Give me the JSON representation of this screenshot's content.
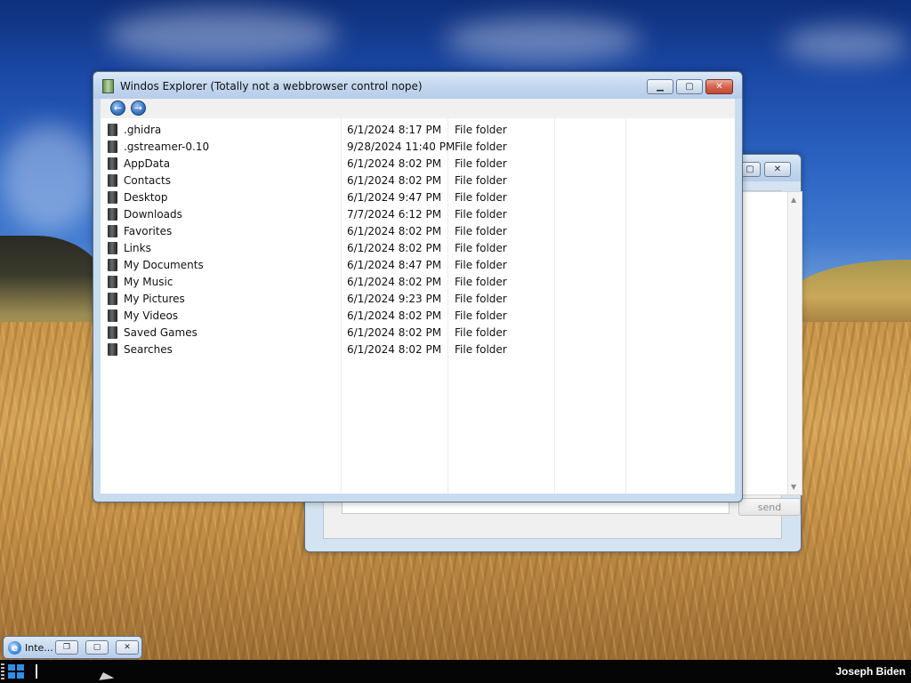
{
  "explorer": {
    "title": "Windos Explorer (Totally not a webbrowser control nope)",
    "buttons": {
      "minimize": "▁",
      "maximize": "▢",
      "close": "✕",
      "back": "←",
      "forward": "→"
    },
    "rows": [
      {
        "name": ".ghidra",
        "date": "6/1/2024 8:17 PM",
        "type": "File folder"
      },
      {
        "name": ".gstreamer-0.10",
        "date": "9/28/2024 11:40 PM",
        "type": "File folder"
      },
      {
        "name": "AppData",
        "date": "6/1/2024 8:02 PM",
        "type": "File folder"
      },
      {
        "name": "Contacts",
        "date": "6/1/2024 8:02 PM",
        "type": "File folder"
      },
      {
        "name": "Desktop",
        "date": "6/1/2024 9:47 PM",
        "type": "File folder"
      },
      {
        "name": "Downloads",
        "date": "7/7/2024 6:12 PM",
        "type": "File folder"
      },
      {
        "name": "Favorites",
        "date": "6/1/2024 8:02 PM",
        "type": "File folder"
      },
      {
        "name": "Links",
        "date": "6/1/2024 8:02 PM",
        "type": "File folder"
      },
      {
        "name": "My Documents",
        "date": "6/1/2024 8:47 PM",
        "type": "File folder"
      },
      {
        "name": "My Music",
        "date": "6/1/2024 8:02 PM",
        "type": "File folder"
      },
      {
        "name": "My Pictures",
        "date": "6/1/2024 9:23 PM",
        "type": "File folder"
      },
      {
        "name": "My Videos",
        "date": "6/1/2024 8:02 PM",
        "type": "File folder"
      },
      {
        "name": "Saved Games",
        "date": "6/1/2024 8:02 PM",
        "type": "File folder"
      },
      {
        "name": "Searches",
        "date": "6/1/2024 8:02 PM",
        "type": "File folder"
      }
    ]
  },
  "chat_window": {
    "send_label": "send",
    "buttons": {
      "maximize": "▢",
      "close": "✕"
    },
    "scroll_up": "▲",
    "scroll_down": "▼"
  },
  "minimized_window": {
    "label": "Inte...",
    "icon_glyph": "e",
    "buttons": {
      "restore": "❐",
      "maximize": "▢",
      "close": "✕"
    }
  },
  "taskbar": {
    "user_name": "Joseph Biden"
  },
  "colors": {
    "title_bar": "#c3d7ee",
    "close_button": "#d7634d",
    "taskbar": "#050505",
    "start_logo": "#2e8fe6"
  }
}
